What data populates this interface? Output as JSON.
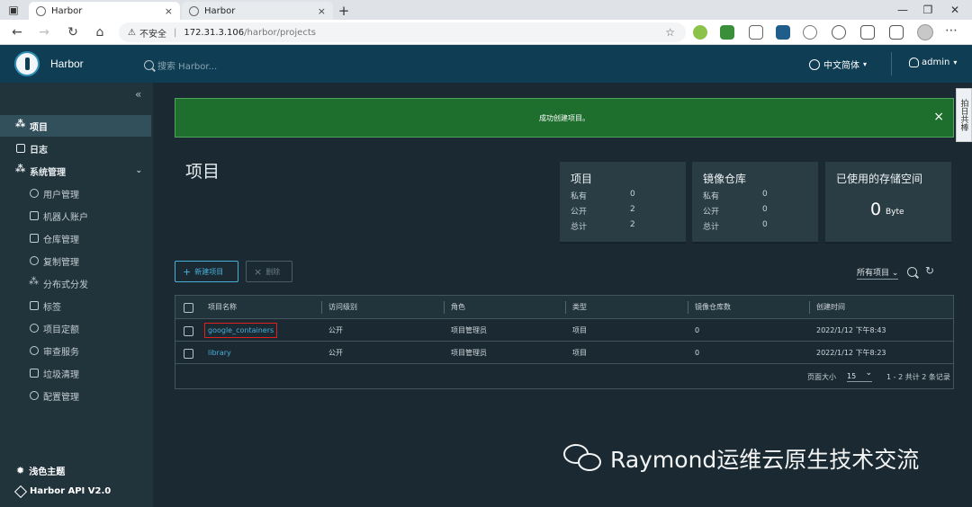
{
  "browser": {
    "tabs": [
      {
        "title": "Harbor",
        "close": "×"
      },
      {
        "title": "Harbor",
        "close": "×"
      }
    ],
    "new_tab": "+",
    "url_warning": "不安全",
    "url_host": "172.31.3.106",
    "url_path": "/harbor/projects"
  },
  "header": {
    "app_name": "Harbor",
    "search_placeholder": "搜索 Harbor...",
    "language": "中文简体",
    "user": "admin"
  },
  "sidebar": {
    "collapse": "«",
    "items": [
      {
        "label": "项目",
        "icon": "projects-icon",
        "active": true
      },
      {
        "label": "日志",
        "icon": "logs-icon"
      },
      {
        "label": "系统管理",
        "icon": "admin-icon"
      },
      {
        "label": "用户管理",
        "icon": "users-icon"
      },
      {
        "label": "机器人账户",
        "icon": "robot-icon"
      },
      {
        "label": "仓库管理",
        "icon": "registry-icon"
      },
      {
        "label": "复制管理",
        "icon": "replication-icon"
      },
      {
        "label": "分布式分发",
        "icon": "distribution-icon"
      },
      {
        "label": "标签",
        "icon": "tag-icon"
      },
      {
        "label": "项目定额",
        "icon": "quota-icon"
      },
      {
        "label": "审查服务",
        "icon": "shield-icon"
      },
      {
        "label": "垃圾清理",
        "icon": "trash-icon"
      },
      {
        "label": "配置管理",
        "icon": "gear-icon"
      }
    ],
    "theme": "浅色主题",
    "api": "Harbor API V2.0"
  },
  "alert": {
    "message": "成功创建项目。",
    "close": "×"
  },
  "side_tab": "拍日共棒",
  "page_title": "项目",
  "cards": {
    "projects": {
      "title": "项目",
      "rows": [
        {
          "k": "私有",
          "v": "0"
        },
        {
          "k": "公开",
          "v": "2"
        },
        {
          "k": "总计",
          "v": "2"
        }
      ]
    },
    "repos": {
      "title": "镜像仓库",
      "rows": [
        {
          "k": "私有",
          "v": "0"
        },
        {
          "k": "公开",
          "v": "0"
        },
        {
          "k": "总计",
          "v": "0"
        }
      ]
    },
    "storage": {
      "title": "已使用的存储空间",
      "value": "0",
      "unit": "Byte"
    }
  },
  "toolbar": {
    "new_project": "新建项目",
    "delete": "删除",
    "filter": "所有项目"
  },
  "table": {
    "headers": [
      "项目名称",
      "访问级别",
      "角色",
      "类型",
      "镜像仓库数",
      "创建时间"
    ],
    "rows": [
      [
        "google_containers",
        "公开",
        "项目管理员",
        "项目",
        "0",
        "2022/1/12 下午8:43"
      ],
      [
        "library",
        "公开",
        "项目管理员",
        "项目",
        "0",
        "2022/1/12 下午8:23"
      ]
    ],
    "page_size_label": "页面大小",
    "page_size": "15",
    "count": "1 - 2 共计 2 条记录"
  },
  "watermark": "Raymond运维云原生技术交流"
}
